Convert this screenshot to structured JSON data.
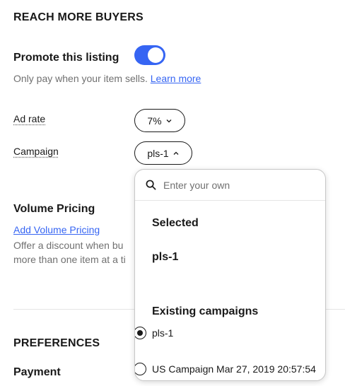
{
  "promote_section": {
    "heading": "REACH MORE BUYERS",
    "title": "Promote this listing",
    "toggle_on": true,
    "description": "Only pay when your item sells.",
    "learn_more": "Learn more"
  },
  "ad_rate": {
    "label": "Ad rate",
    "value": "7%"
  },
  "campaign": {
    "label": "Campaign",
    "value": "pls-1"
  },
  "volume_pricing": {
    "title": "Volume Pricing",
    "link": "Add Volume Pricing",
    "description_line1": "Offer a discount when bu",
    "description_line2": "more than one item at a ti"
  },
  "preferences": {
    "heading": "PREFERENCES",
    "payment_label": "Payment"
  },
  "dropdown": {
    "search_placeholder": "Enter your own",
    "selected_heading": "Selected",
    "selected_value": "pls-1",
    "existing_heading": "Existing campaigns",
    "options": [
      {
        "label": "pls-1",
        "checked": true
      },
      {
        "label": "US Campaign Mar 27, 2019 20:57:54",
        "checked": false
      }
    ]
  },
  "colors": {
    "accent": "#3665f3",
    "text": "#191919",
    "muted": "#707070"
  }
}
